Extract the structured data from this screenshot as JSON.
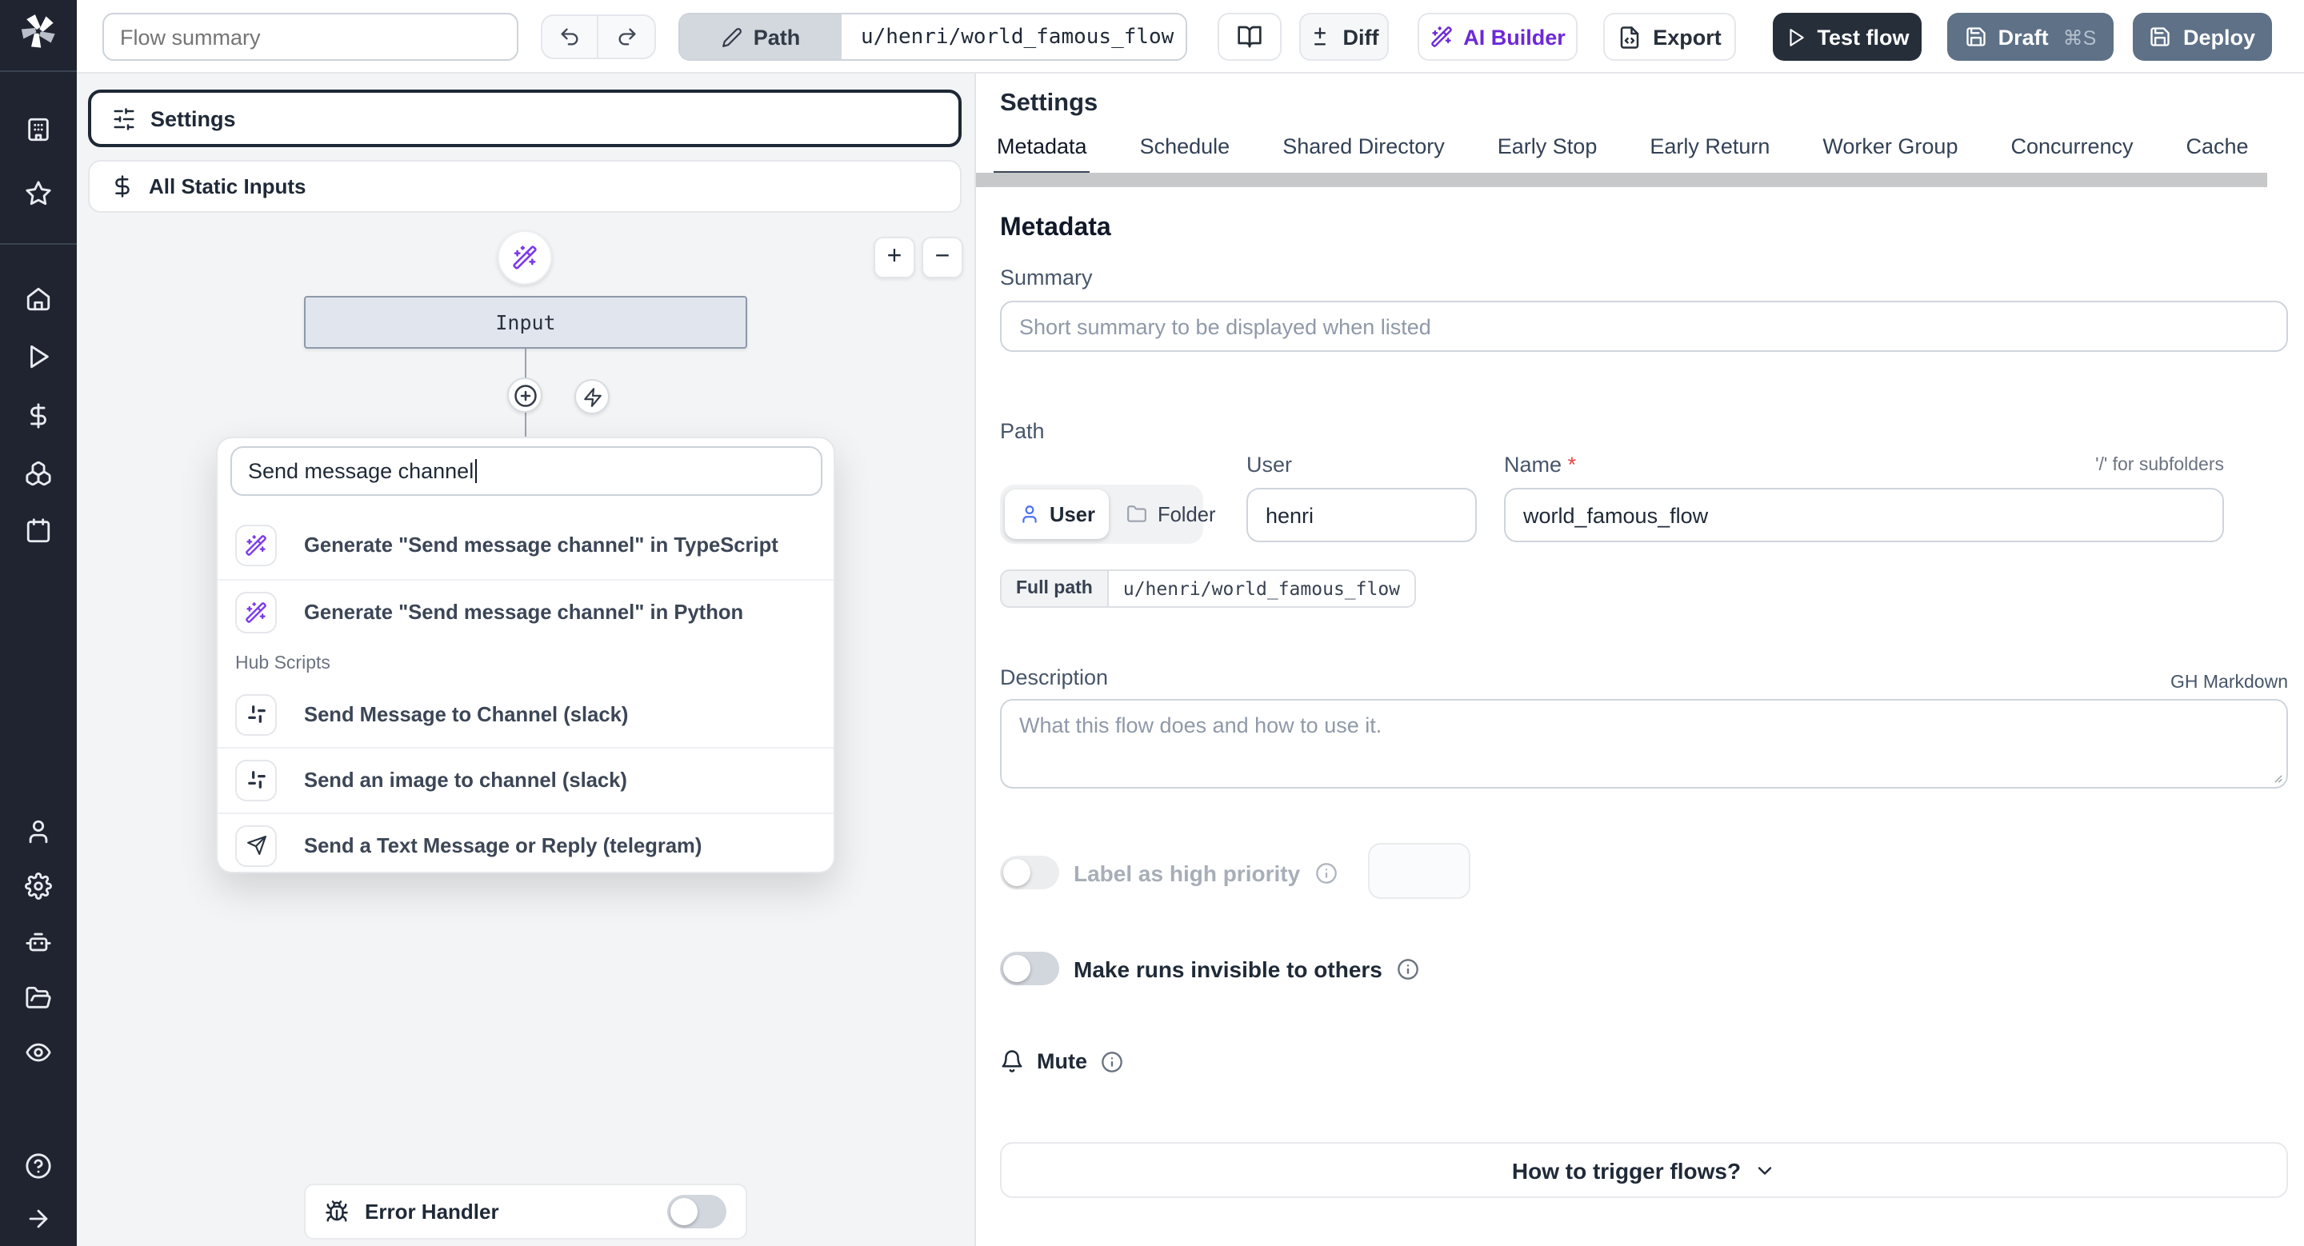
{
  "toolbar": {
    "flow_summary_placeholder": "Flow summary",
    "path_button": "Path",
    "path_value": "u/henri/world_famous_flow",
    "diff": "Diff",
    "ai_builder": "AI Builder",
    "export": "Export",
    "test_flow": "Test flow",
    "draft": "Draft",
    "draft_shortcut": "⌘S",
    "deploy": "Deploy"
  },
  "flow_panel": {
    "settings": "Settings",
    "all_static_inputs": "All Static Inputs",
    "input_node": "Input",
    "zoom_in": "+",
    "zoom_out": "−",
    "search_value": "Send message channel",
    "ai_suggestions": [
      {
        "label": "Generate \"Send message channel\" in TypeScript",
        "icon": "wand-sparkles-icon"
      },
      {
        "label": "Generate \"Send message channel\" in Python",
        "icon": "wand-sparkles-icon"
      }
    ],
    "hub_section_label": "Hub Scripts",
    "hub_scripts": [
      {
        "label": "Send Message to Channel (slack)",
        "icon": "slack-icon"
      },
      {
        "label": "Send an image to channel (slack)",
        "icon": "slack-icon"
      },
      {
        "label": "Send a Text Message or Reply (telegram)",
        "icon": "telegram-icon"
      }
    ],
    "error_handler": "Error Handler"
  },
  "settings_panel": {
    "title": "Settings",
    "tabs": [
      "Metadata",
      "Schedule",
      "Shared Directory",
      "Early Stop",
      "Early Return",
      "Worker Group",
      "Concurrency",
      "Cache"
    ],
    "active_tab": "Metadata",
    "section_title": "Metadata",
    "summary_label": "Summary",
    "summary_placeholder": "Short summary to be displayed when listed",
    "path_label": "Path",
    "owner_user": "User",
    "owner_folder": "Folder",
    "owner_selected": "User",
    "user_label": "User",
    "user_value": "henri",
    "name_label": "Name",
    "name_required_mark": "*",
    "name_value": "world_famous_flow",
    "subfolder_hint": "'/' for subfolders",
    "full_path_label": "Full path",
    "full_path_value": "u/henri/world_famous_flow",
    "description_label": "Description",
    "markdown_hint": "GH Markdown",
    "description_placeholder": "What this flow does and how to use it.",
    "high_priority_label": "Label as high priority",
    "invisible_label": "Make runs invisible to others",
    "mute_label": "Mute",
    "trigger_help": "How to trigger flows?"
  },
  "sidebar_icons": [
    "windmill-logo",
    "workspace",
    "favorites",
    "home",
    "runs",
    "variables",
    "resources",
    "schedules",
    "users",
    "settings",
    "workers",
    "folders",
    "audit-logs",
    "help",
    "expand"
  ],
  "colors": {
    "accent_purple": "#6d28d9",
    "dark_button": "#262e39",
    "deploy_button": "#5e7187",
    "sidebar_bg": "#1f2430",
    "active_tab_underline": "#3b4656"
  }
}
